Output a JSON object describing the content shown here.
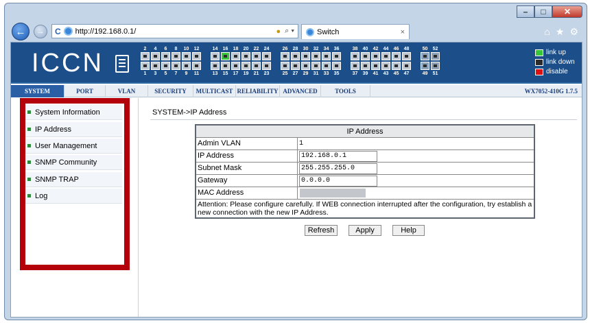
{
  "browser": {
    "address": "http://192.168.0.1/",
    "search_icon": "search-icon",
    "tab_title": "Switch",
    "tab_close": "×"
  },
  "banner": {
    "logo": "ICCN",
    "ports_top_numbers": [
      "2",
      "4",
      "6",
      "8",
      "10",
      "12",
      "14",
      "16",
      "18",
      "20",
      "22",
      "24",
      "26",
      "28",
      "30",
      "32",
      "34",
      "36",
      "38",
      "40",
      "42",
      "44",
      "46",
      "48",
      "50",
      "52"
    ],
    "ports_bottom_numbers": [
      "1",
      "3",
      "5",
      "7",
      "9",
      "11",
      "13",
      "15",
      "17",
      "19",
      "21",
      "23",
      "25",
      "27",
      "29",
      "31",
      "33",
      "35",
      "37",
      "39",
      "41",
      "43",
      "45",
      "47",
      "49",
      "51"
    ],
    "link_up_port": "16",
    "legend": {
      "link_up": "link up",
      "link_down": "link down",
      "disable": "disable"
    },
    "colors": {
      "link_up": "#37c637",
      "link_down": "#2b2b2b",
      "disable": "#d11"
    }
  },
  "menu": {
    "items": [
      "SYSTEM",
      "PORT",
      "VLAN",
      "SECURITY",
      "MULTICAST",
      "RELIABILITY",
      "ADVANCED",
      "TOOLS"
    ],
    "active": "SYSTEM",
    "version": "WX7052-410G 1.7.5"
  },
  "sidebar": {
    "items": [
      {
        "label": "System Information"
      },
      {
        "label": "IP Address"
      },
      {
        "label": "User Management"
      },
      {
        "label": "SNMP Community"
      },
      {
        "label": "SNMP TRAP"
      },
      {
        "label": "Log"
      }
    ]
  },
  "main": {
    "breadcrumb": "SYSTEM->IP Address",
    "table_title": "IP Address",
    "rows": {
      "admin_vlan_label": "Admin VLAN",
      "admin_vlan_value": "1",
      "ip_label": "IP Address",
      "ip_value": "192.168.0.1",
      "mask_label": "Subnet Mask",
      "mask_value": "255.255.255.0",
      "gw_label": "Gateway",
      "gw_value": "0.0.0.0",
      "mac_label": "MAC Address"
    },
    "attention": "Attention: Please configure carefully. If WEB connection interrupted after the configuration, try establish a new connection with the new IP Address.",
    "buttons": {
      "refresh": "Refresh",
      "apply": "Apply",
      "help": "Help"
    }
  }
}
